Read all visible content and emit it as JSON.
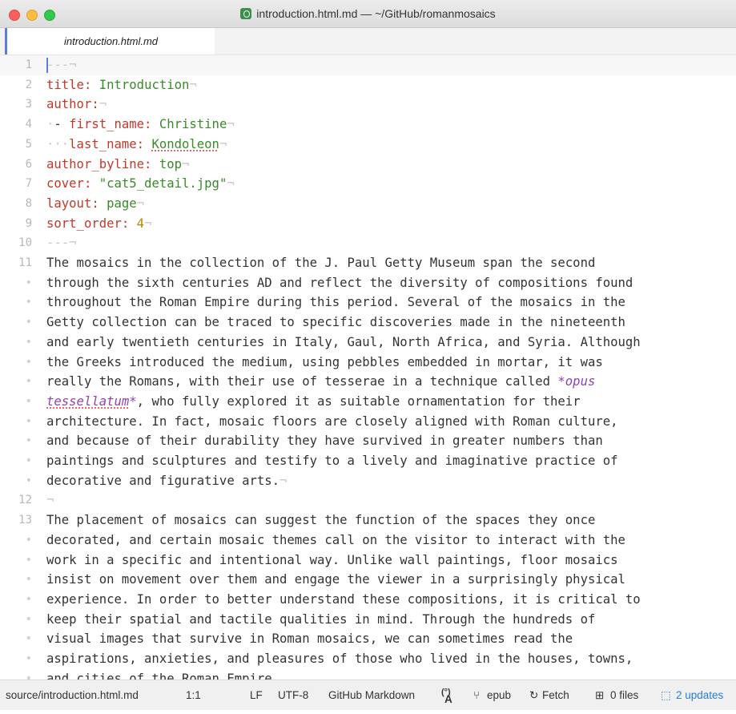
{
  "window": {
    "title": "introduction.html.md — ~/GitHub/romanmosaics"
  },
  "tabs": [
    {
      "label": "introduction.html.md"
    }
  ],
  "editor": {
    "lines": [
      {
        "gutter": "1",
        "tokens": [
          {
            "t": "---",
            "c": "inv"
          },
          {
            "t": "¬",
            "c": "inv"
          }
        ]
      },
      {
        "gutter": "2",
        "tokens": [
          {
            "t": "title:",
            "c": "k"
          },
          {
            "t": " "
          },
          {
            "t": "Introduction",
            "c": "s"
          },
          {
            "t": "¬",
            "c": "inv"
          }
        ]
      },
      {
        "gutter": "3",
        "tokens": [
          {
            "t": "author:",
            "c": "k"
          },
          {
            "t": "¬",
            "c": "inv"
          }
        ]
      },
      {
        "gutter": "4",
        "tokens": [
          {
            "t": "·",
            "c": "inv"
          },
          {
            "t": "- "
          },
          {
            "t": "first_name:",
            "c": "k"
          },
          {
            "t": " "
          },
          {
            "t": "Christine",
            "c": "s"
          },
          {
            "t": "¬",
            "c": "inv"
          }
        ]
      },
      {
        "gutter": "5",
        "tokens": [
          {
            "t": "···",
            "c": "inv"
          },
          {
            "t": "last_name:",
            "c": "k"
          },
          {
            "t": " "
          },
          {
            "t": "Kondoleon",
            "c": "s sq"
          },
          {
            "t": "¬",
            "c": "inv"
          }
        ]
      },
      {
        "gutter": "6",
        "tokens": [
          {
            "t": "author_byline:",
            "c": "k"
          },
          {
            "t": " "
          },
          {
            "t": "top",
            "c": "s"
          },
          {
            "t": "¬",
            "c": "inv"
          }
        ]
      },
      {
        "gutter": "7",
        "tokens": [
          {
            "t": "cover:",
            "c": "k"
          },
          {
            "t": " "
          },
          {
            "t": "\"cat5_detail.jpg\"",
            "c": "s"
          },
          {
            "t": "¬",
            "c": "inv"
          }
        ]
      },
      {
        "gutter": "8",
        "tokens": [
          {
            "t": "layout:",
            "c": "k"
          },
          {
            "t": " "
          },
          {
            "t": "page",
            "c": "s"
          },
          {
            "t": "¬",
            "c": "inv"
          }
        ]
      },
      {
        "gutter": "9",
        "tokens": [
          {
            "t": "sort_order:",
            "c": "k"
          },
          {
            "t": " "
          },
          {
            "t": "4",
            "c": "num"
          },
          {
            "t": "¬",
            "c": "inv"
          }
        ]
      },
      {
        "gutter": "10",
        "tokens": [
          {
            "t": "---",
            "c": "inv"
          },
          {
            "t": "¬",
            "c": "inv"
          }
        ]
      },
      {
        "gutter": "11",
        "tokens": [
          {
            "t": "The mosaics in the collection of the J. Paul Getty Museum span the second"
          }
        ]
      },
      {
        "gutter": "•",
        "tokens": [
          {
            "t": "through the sixth centuries AD and reflect the diversity of compositions found"
          }
        ]
      },
      {
        "gutter": "•",
        "tokens": [
          {
            "t": "throughout the Roman Empire during this period. Several of the mosaics in the"
          }
        ]
      },
      {
        "gutter": "•",
        "tokens": [
          {
            "t": "Getty collection can be traced to specific discoveries made in the nineteenth"
          }
        ]
      },
      {
        "gutter": "•",
        "tokens": [
          {
            "t": "and early twentieth centuries in Italy, Gaul, North Africa, and Syria. Although"
          }
        ]
      },
      {
        "gutter": "•",
        "tokens": [
          {
            "t": "the Greeks introduced the medium, using pebbles embedded in mortar, it was"
          }
        ]
      },
      {
        "gutter": "•",
        "tokens": [
          {
            "t": "really the Romans, with their use of tesserae in a technique called "
          },
          {
            "t": "*opus",
            "c": "em"
          }
        ]
      },
      {
        "gutter": "•",
        "tokens": [
          {
            "t": "tessellatum",
            "c": "em sq"
          },
          {
            "t": "*",
            "c": "em"
          },
          {
            "t": ", who fully explored it as suitable ornamentation for their"
          }
        ]
      },
      {
        "gutter": "•",
        "tokens": [
          {
            "t": "architecture. In fact, mosaic floors are closely aligned with Roman culture,"
          }
        ]
      },
      {
        "gutter": "•",
        "tokens": [
          {
            "t": "and because of their durability they have survived in greater numbers than"
          }
        ]
      },
      {
        "gutter": "•",
        "tokens": [
          {
            "t": "paintings and sculptures and testify to a lively and imaginative practice of"
          }
        ]
      },
      {
        "gutter": "•",
        "tokens": [
          {
            "t": "decorative and figurative arts."
          },
          {
            "t": "¬",
            "c": "inv"
          }
        ]
      },
      {
        "gutter": "12",
        "tokens": [
          {
            "t": "¬",
            "c": "inv"
          }
        ]
      },
      {
        "gutter": "13",
        "tokens": [
          {
            "t": "The placement of mosaics can suggest the function of the spaces they once"
          }
        ]
      },
      {
        "gutter": "•",
        "tokens": [
          {
            "t": "decorated, and certain mosaic themes call on the visitor to interact with the"
          }
        ]
      },
      {
        "gutter": "•",
        "tokens": [
          {
            "t": "work in a specific and intentional way. Unlike wall paintings, floor mosaics"
          }
        ]
      },
      {
        "gutter": "•",
        "tokens": [
          {
            "t": "insist on movement over them and engage the viewer in a surprisingly physical"
          }
        ]
      },
      {
        "gutter": "•",
        "tokens": [
          {
            "t": "experience. In order to better understand these compositions, it is critical to"
          }
        ]
      },
      {
        "gutter": "•",
        "tokens": [
          {
            "t": "keep their spatial and tactile qualities in mind. Through the hundreds of"
          }
        ]
      },
      {
        "gutter": "•",
        "tokens": [
          {
            "t": "visual images that survive in Roman mosaics, we can sometimes read the"
          }
        ]
      },
      {
        "gutter": "•",
        "tokens": [
          {
            "t": "aspirations, anxieties, and pleasures of those who lived in the houses, towns,"
          }
        ]
      },
      {
        "gutter": "•",
        "tokens": [
          {
            "t": "and cities of the Roman Empire."
          }
        ]
      }
    ]
  },
  "status": {
    "path": "source/introduction.html.md",
    "position": "1:1",
    "line_ending": "LF",
    "encoding": "UTF-8",
    "grammar": "GitHub Markdown",
    "branch": "epub",
    "fetch": "Fetch",
    "files": "0 files",
    "updates": "2 updates"
  },
  "colors": {
    "accent": "#5a7fd6",
    "key": "#c0392b",
    "string": "#3a8a2a",
    "emphasis": "#8e44ad",
    "updates": "#2a7fd4"
  }
}
